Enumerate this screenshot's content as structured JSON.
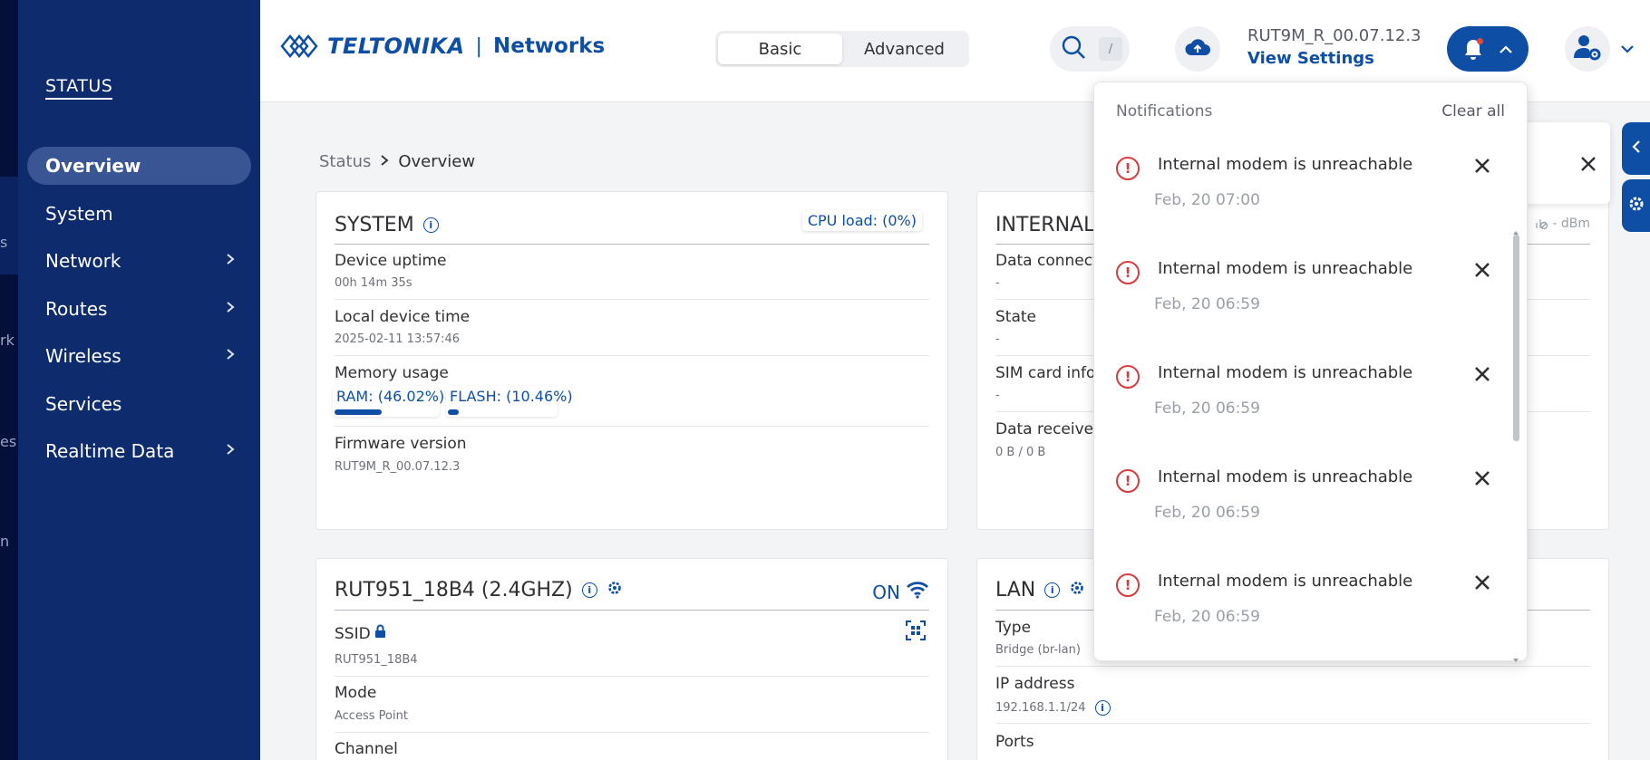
{
  "rail": {
    "items": [
      "s",
      "rk",
      "es",
      "n"
    ]
  },
  "sidebar": {
    "section_title": "STATUS",
    "items": [
      {
        "label": "Overview",
        "active": true,
        "chevron": false
      },
      {
        "label": "System",
        "active": false,
        "chevron": false
      },
      {
        "label": "Network",
        "active": false,
        "chevron": true
      },
      {
        "label": "Routes",
        "active": false,
        "chevron": true
      },
      {
        "label": "Wireless",
        "active": false,
        "chevron": true
      },
      {
        "label": "Services",
        "active": false,
        "chevron": false
      },
      {
        "label": "Realtime Data",
        "active": false,
        "chevron": true
      }
    ]
  },
  "header": {
    "brand": "TELTONIKA",
    "brand_sep": "|",
    "brand_sub": "Networks",
    "mode_basic": "Basic",
    "mode_advanced": "Advanced",
    "search_shortcut": "/",
    "firmware": "RUT9M_R_00.07.12.3",
    "view_settings": "View Settings"
  },
  "breadcrumb": {
    "parent": "Status",
    "current": "Overview"
  },
  "system_card": {
    "title": "SYSTEM",
    "cpu_load": "CPU load: (0%)",
    "uptime_label": "Device uptime",
    "uptime_value": "00h 14m 35s",
    "time_label": "Local device time",
    "time_value": "2025-02-11 13:57:46",
    "memory_label": "Memory usage",
    "ram": "RAM: (46.02%)",
    "ram_fraction": 0.4602,
    "flash": "FLASH: (10.46%)",
    "flash_fraction": 0.1046,
    "firmware_label": "Firmware version",
    "firmware_value": "RUT9M_R_00.07.12.3"
  },
  "internal_card": {
    "title": "INTERNAL",
    "signal": "- dBm",
    "rows": [
      {
        "label": "Data connectio",
        "value": "-"
      },
      {
        "label": "State",
        "value": "-"
      },
      {
        "label": "SIM card info",
        "value": "-"
      },
      {
        "label": "Data received",
        "value": "0 B / 0 B"
      }
    ]
  },
  "wifi_card": {
    "title": "RUT951_18B4 (2.4GHZ)",
    "state": "ON",
    "ssid_label": "SSID",
    "ssid_value": "RUT951_18B4",
    "mode_label": "Mode",
    "mode_value": "Access Point",
    "channel_label": "Channel"
  },
  "lan_card": {
    "title": "LAN",
    "type_label": "Type",
    "type_value": "Bridge (br-lan)",
    "ip_label": "IP address",
    "ip_value": "192.168.1.1/24",
    "ports_label": "Ports"
  },
  "notifications": {
    "title": "Notifications",
    "clear_all": "Clear all",
    "items": [
      {
        "message": "Internal modem is unreachable",
        "time": "Feb, 20 07:00"
      },
      {
        "message": "Internal modem is unreachable",
        "time": "Feb, 20 06:59"
      },
      {
        "message": "Internal modem is unreachable",
        "time": "Feb, 20 06:59"
      },
      {
        "message": "Internal modem is unreachable",
        "time": "Feb, 20 06:59"
      },
      {
        "message": "Internal modem is unreachable",
        "time": "Feb, 20 06:59"
      }
    ]
  },
  "colors": {
    "sidebar_bg": "#0e2b6d",
    "rail_bg": "#04103a",
    "accent": "#0e4fa5",
    "error": "#d93b3b",
    "badge": "#e8453c"
  }
}
